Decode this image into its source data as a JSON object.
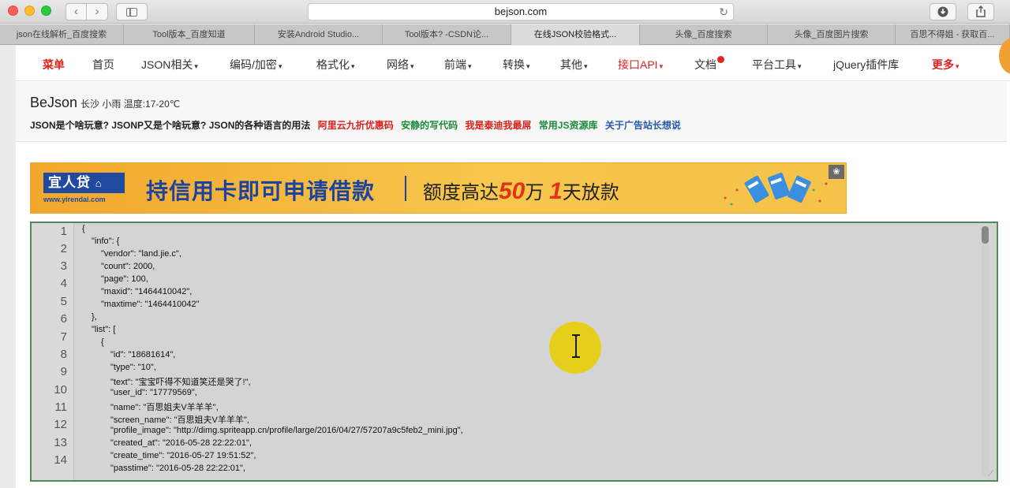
{
  "browser": {
    "url": "bejson.com",
    "reload_icon": "↻",
    "back_icon": "‹",
    "forward_icon": "›"
  },
  "tabs": [
    {
      "label": "json在线解析_百度搜索"
    },
    {
      "label": "Tool版本_百度知道"
    },
    {
      "label": "安装Android Studio..."
    },
    {
      "label": "Tool版本? -CSDN论..."
    },
    {
      "label": "在线JSON校验格式..."
    },
    {
      "label": "头像_百度搜索"
    },
    {
      "label": "头像_百度图片搜索"
    },
    {
      "label": "百思不得姐 - 获取百..."
    }
  ],
  "menu": {
    "items": [
      {
        "label": "菜单"
      },
      {
        "label": "首页"
      },
      {
        "label": "JSON相关"
      },
      {
        "label": "编码/加密"
      },
      {
        "label": "格式化"
      },
      {
        "label": "网络"
      },
      {
        "label": "前端"
      },
      {
        "label": "转换"
      },
      {
        "label": "其他"
      },
      {
        "label": "接口API"
      },
      {
        "label": "文档"
      },
      {
        "label": "平台工具"
      },
      {
        "label": "jQuery插件库"
      },
      {
        "label": "更多"
      }
    ],
    "caret": "▾"
  },
  "info": {
    "brand": "BeJson",
    "weather": "长沙 小雨 温度:17-20℃",
    "links": [
      {
        "label": "JSON是个啥玩意? JSONP又是个啥玩意? JSON的各种语言的用法"
      },
      {
        "label": "阿里云九折优惠码"
      },
      {
        "label": "安静的写代码"
      },
      {
        "label": "我是泰迪我最屌"
      },
      {
        "label": "常用JS资源库"
      },
      {
        "label": "关于广告站长想说"
      }
    ]
  },
  "banner": {
    "logo": "宜人贷",
    "logo_url": "www.yirendai.com",
    "main": "持信用卡即可申请借款",
    "sub_prefix": "额度高达",
    "amount": "50",
    "unit": "万",
    "days": "1",
    "sub_suffix": "天放款",
    "paw_icon": "❀"
  },
  "editor": {
    "line_numbers": [
      "1",
      "2",
      "3",
      "4",
      "5",
      "6",
      "7",
      "8",
      "9",
      "10",
      "11",
      "12",
      "13",
      "14"
    ],
    "lines": [
      "{",
      "\"info\": {",
      "\"vendor\": \"land.jie.c\",",
      "\"count\": 2000,",
      "\"page\": 100,",
      "\"maxid\": \"1464410042\",",
      "\"maxtime\": \"1464410042\"",
      "},",
      "\"list\": [",
      "{",
      "\"id\": \"18681614\",",
      "\"type\": \"10\",",
      "\"text\": \"宝宝吓得不知道笑还是哭了!\",",
      "\"user_id\": \"17779569\",",
      "\"name\": \"百思姐夫V羊羊羊\",",
      "\"screen_name\": \"百思姐夫V羊羊羊\",",
      "\"profile_image\": \"http://dimg.spriteapp.cn/profile/large/2016/04/27/57207a9c5feb2_mini.jpg\",",
      "\"created_at\": \"2016-05-28 22:22:01\",",
      "\"create_time\": \"2016-05-27 19:51:52\",",
      "\"passtime\": \"2016-05-28 22:22:01\","
    ]
  }
}
